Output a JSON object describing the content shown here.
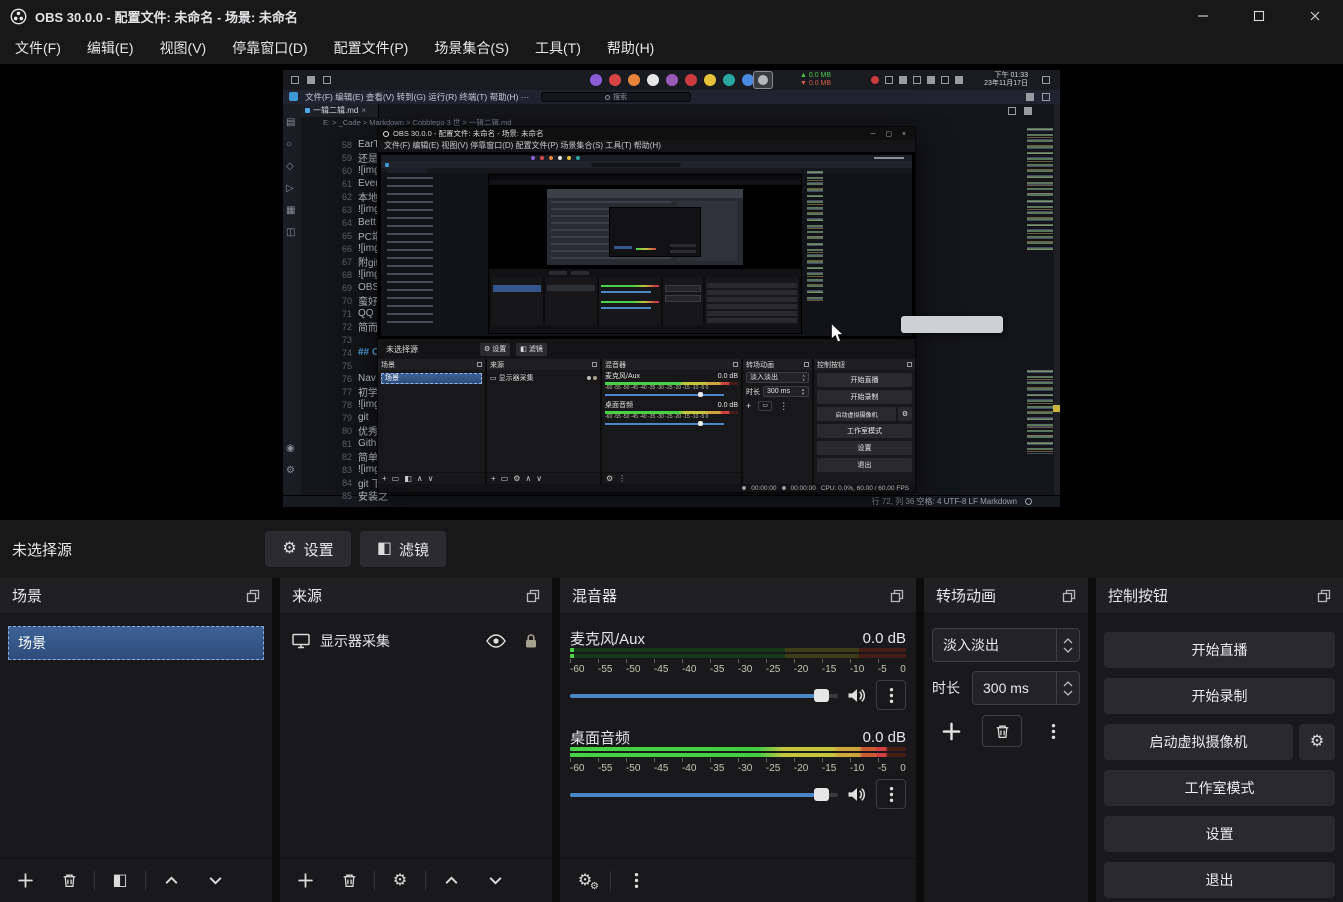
{
  "app": {
    "title": "OBS 30.0.0 - 配置文件: 未命名 - 场景: 未命名",
    "menus": [
      "文件(F)",
      "编辑(E)",
      "视图(V)",
      "停靠窗口(D)",
      "配置文件(P)",
      "场景集合(S)",
      "工具(T)",
      "帮助(H)"
    ]
  },
  "source_toolbar": {
    "no_source": "未选择源",
    "settings": "设置",
    "filters": "滤镜"
  },
  "scenes_dock": {
    "title": "场景",
    "items": [
      {
        "label": "场景"
      }
    ]
  },
  "sources_dock": {
    "title": "来源",
    "items": [
      {
        "label": "显示器采集"
      }
    ]
  },
  "mixer_dock": {
    "title": "混音器",
    "ticks": [
      "-60",
      "-55",
      "-50",
      "-45",
      "-40",
      "-35",
      "-30",
      "-25",
      "-20",
      "-15",
      "-10",
      "-5",
      "0"
    ],
    "channels": [
      {
        "name": "麦克风/Aux",
        "level": "0.0 dB"
      },
      {
        "name": "桌面音频",
        "level": "0.0 dB"
      }
    ]
  },
  "transitions_dock": {
    "title": "转场动画",
    "transition": "淡入淡出",
    "duration_label": "时长",
    "duration_value": "300 ms"
  },
  "controls_dock": {
    "title": "控制按钮",
    "stream": "开始直播",
    "record": "开始录制",
    "virtual_cam": "启动虚拟摄像机",
    "studio_mode": "工作室模式",
    "settings": "设置",
    "exit": "退出"
  },
  "capture": {
    "tray": {
      "net_up": "0.0 MB",
      "net_down": "0.0 MB",
      "time": "下午 01:33",
      "date": "23年11月17日"
    },
    "vscode": {
      "menu": "文件(F)   编辑(E)   查看(V)   转到(G)   运行(R)   终端(T)   帮助(H)   ···",
      "search": "搜索",
      "tab": "一辑二辑.md",
      "breadcrumb": "E: > _Code > Markdown > Cobblepo 3 世 > 一辑二辑.md",
      "status_right": "行 72, 列 36    空格: 4    UTF-8    LF    Markdown",
      "lines": [
        {
          "n": "58",
          "t": "EarT"
        },
        {
          "n": "59",
          "t": "还是是"
        },
        {
          "n": "60",
          "t": "![img"
        },
        {
          "n": "61",
          "t": "Ever"
        },
        {
          "n": "62",
          "t": "本地文"
        },
        {
          "n": "63",
          "t": "![img"
        },
        {
          "n": "64",
          "t": "Bett"
        },
        {
          "n": "65",
          "t": "PC端"
        },
        {
          "n": "66",
          "t": "![img"
        },
        {
          "n": "67",
          "t": "附gith"
        },
        {
          "n": "68",
          "t": "![img"
        },
        {
          "n": "69",
          "t": "OBS"
        },
        {
          "n": "70",
          "t": "蛮好用"
        },
        {
          "n": "71",
          "t": "QQ"
        },
        {
          "n": "72",
          "t": "简而言"
        },
        {
          "n": "73",
          "t": ""
        },
        {
          "n": "74",
          "t": "## CS",
          "cls": "md-heading"
        },
        {
          "n": "75",
          "t": ""
        },
        {
          "n": "76",
          "t": "Nav"
        },
        {
          "n": "77",
          "t": "初学者"
        },
        {
          "n": "78",
          "t": "![img"
        },
        {
          "n": "79",
          "t": "git"
        },
        {
          "n": "80",
          "t": "优秀的"
        },
        {
          "n": "81",
          "t": "Githu"
        },
        {
          "n": "82",
          "t": "简单稳"
        },
        {
          "n": "83",
          "t": "![img"
        },
        {
          "n": "84",
          "t": "git 下"
        },
        {
          "n": "85",
          "t": "安装之"
        }
      ]
    },
    "obs": {
      "title": "OBS 30.0.0 - 配置文件: 未命名 - 场景: 未命名",
      "menu": "文件(F)   编辑(E)   视图(V)   停靠窗口(D)   配置文件(P)   场景集合(S)   工具(T)   帮助(H)",
      "no_source": "未选择源",
      "settings_btn": "设置",
      "filters_btn": "滤镜",
      "scenes_title": "场景",
      "scene_item": "场景",
      "sources_title": "来源",
      "source_item": "显示器采集",
      "mixer_title": "混音器",
      "mic_name": "麦克风/Aux",
      "mic_level": "0.0 dB",
      "desktop_name": "桌面音频",
      "desktop_level": "0.0 dB",
      "ticks": "-60 -55 -50 -45 -40 -35 -30 -25 -20 -15 -10 -5  0",
      "transitions_title": "转场动画",
      "transition": "淡入淡出",
      "duration_label": "时长",
      "duration_value": "300 ms",
      "controls_title": "控制按钮",
      "stream": "开始直播",
      "record": "开始录制",
      "virtual_cam": "启动虚拟摄像机",
      "studio_mode": "工作室模式",
      "settings": "设置",
      "exit": "退出",
      "stream_time": "00:00:00",
      "rec_time": "00:00:00",
      "cpu": "CPU: 0.0%,  60.00 / 60.00 FPS"
    }
  },
  "theme": {
    "accent_blue": "#4a86c8",
    "selection_blue": "#3a5a8c",
    "meter_green": "#47d147",
    "meter_yellow": "#c6c63e",
    "meter_red": "#d14040",
    "record_red": "#d84545"
  }
}
